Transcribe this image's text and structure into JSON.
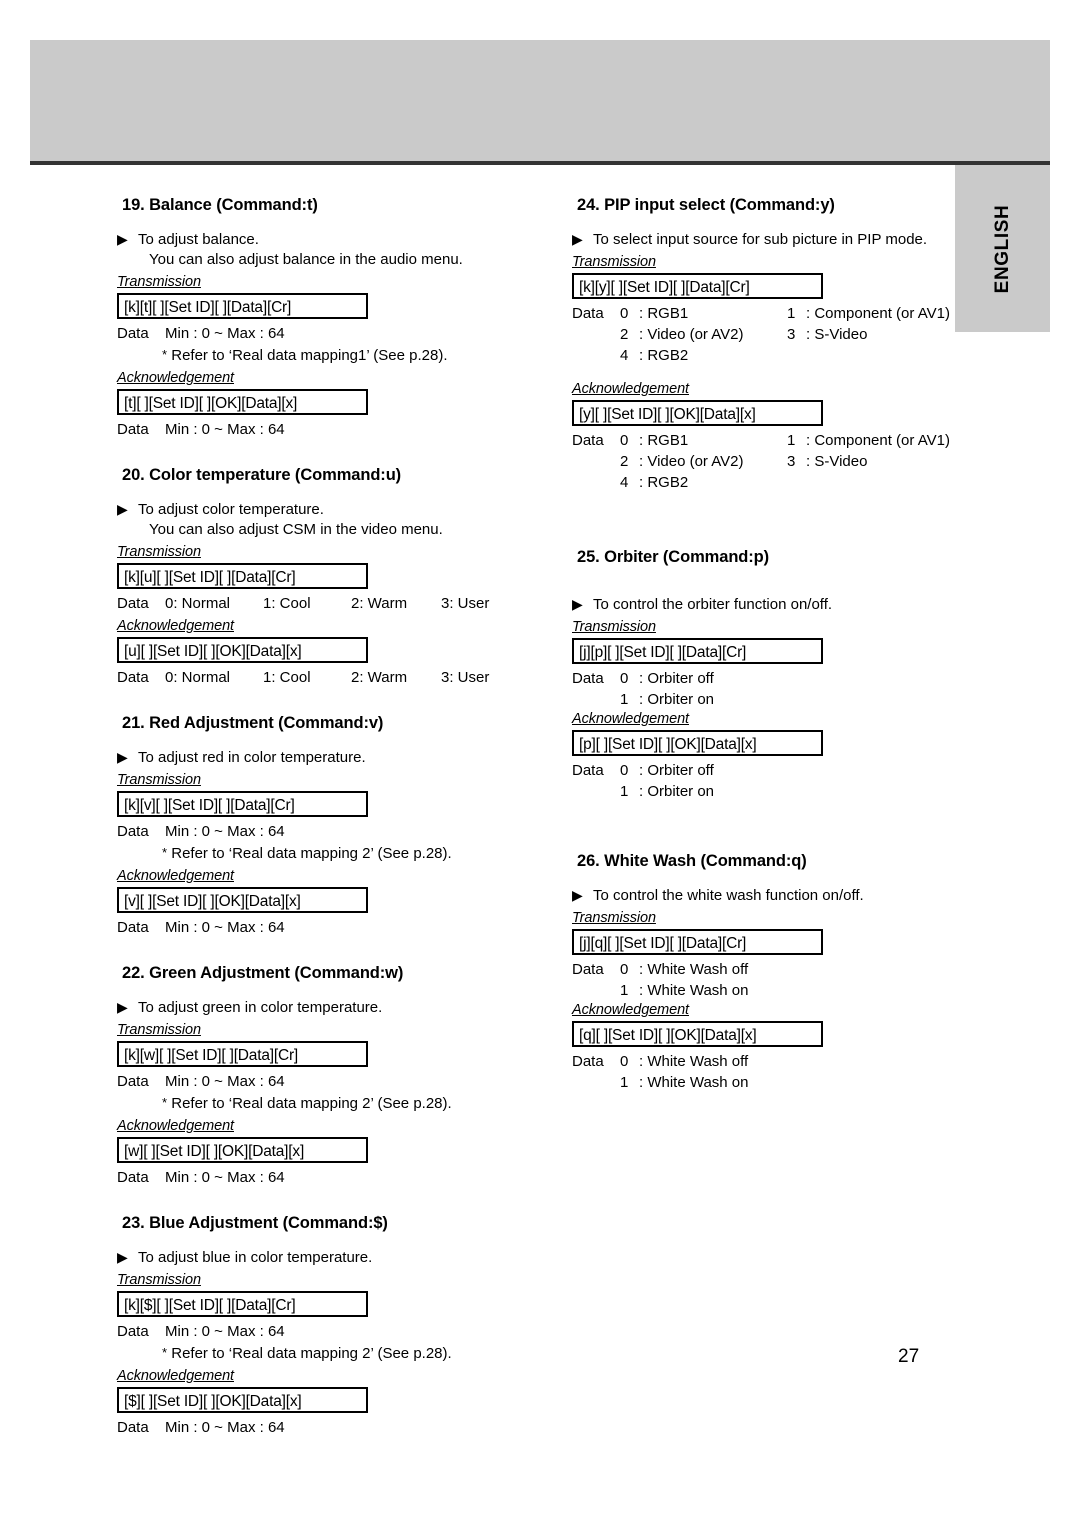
{
  "page": {
    "number": "27",
    "side_tab_label": "ENGLISH"
  },
  "labels": {
    "transmission": "Transmission",
    "acknowledgement": "Acknowledgement",
    "data": "Data",
    "triangle_bullet": "▶",
    "asterisk": "*"
  },
  "left_column": [
    {
      "title": "19. Balance (Command:t)",
      "desc_line1": "To adjust balance.",
      "desc_line2": "You can also adjust balance in the audio menu.",
      "transmission_box": "[k][t][  ][Set ID][  ][Data][Cr]",
      "transmission_data": "Min : 0 ~ Max : 64",
      "transmission_note": "Refer to ‘Real data mapping1’ (See p.28).",
      "ack_box": "[t][  ][Set ID][  ][OK][Data][x]",
      "ack_data": "Min : 0 ~ Max : 64"
    },
    {
      "title": "20. Color temperature (Command:u)",
      "desc_line1": "To adjust color temperature.",
      "desc_line2": "You can also adjust CSM in the video menu.",
      "transmission_box": "[k][u][  ][Set ID][  ][Data][Cr]",
      "options": [
        "0: Normal",
        "1: Cool",
        "2: Warm",
        "3: User"
      ],
      "ack_box": "[u][  ][Set ID][  ][OK][Data][x]",
      "ack_options": [
        "0: Normal",
        "1: Cool",
        "2: Warm",
        "3: User"
      ]
    },
    {
      "title": "21. Red Adjustment (Command:v)",
      "desc_line1": "To adjust red in color temperature.",
      "transmission_box": "[k][v][  ][Set ID][  ][Data][Cr]",
      "transmission_data": "Min : 0 ~ Max : 64",
      "transmission_note": "Refer to ‘Real data mapping 2’ (See p.28).",
      "ack_box": "[v][  ][Set ID][  ][OK][Data][x]",
      "ack_data": "Min : 0 ~ Max : 64"
    },
    {
      "title": "22. Green Adjustment (Command:w)",
      "desc_line1": "To adjust green in color temperature.",
      "transmission_box": "[k][w][  ][Set ID][  ][Data][Cr]",
      "transmission_data": "Min : 0 ~ Max : 64",
      "transmission_note": "Refer to ‘Real data mapping 2’ (See p.28).",
      "ack_box": "[w][  ][Set ID][  ][OK][Data][x]",
      "ack_data": "Min : 0 ~ Max : 64"
    },
    {
      "title": "23. Blue Adjustment (Command:$)",
      "desc_line1": "To adjust blue in color temperature.",
      "transmission_box": "[k][$][  ][Set ID][  ][Data][Cr]",
      "transmission_data": "Min : 0 ~ Max : 64",
      "transmission_note": "Refer to ‘Real data mapping 2’ (See p.28).",
      "ack_box": "[$][  ][Set ID][  ][OK][Data][x]",
      "ack_data": "Min : 0 ~ Max : 64"
    }
  ],
  "right_column": [
    {
      "title": "24. PIP input select (Command:y)",
      "desc_line1": "To select input source for sub picture in PIP mode.",
      "transmission_box": "[k][y][  ][Set ID][  ][Data][Cr]",
      "values": [
        {
          "n1": "0",
          "v1": ": RGB1",
          "n2": "1",
          "v2": ": Component (or AV1)"
        },
        {
          "n1": "2",
          "v1": ": Video (or AV2)",
          "n2": "3",
          "v2": ": S-Video"
        },
        {
          "n1": "4",
          "v1": ": RGB2",
          "n2": "",
          "v2": ""
        }
      ],
      "ack_box": "[y][  ][Set ID][  ][OK][Data][x]",
      "ack_values": [
        {
          "n1": "0",
          "v1": ": RGB1",
          "n2": "1",
          "v2": ": Component (or AV1)"
        },
        {
          "n1": "2",
          "v1": ": Video (or AV2)",
          "n2": "3",
          "v2": ": S-Video"
        },
        {
          "n1": "4",
          "v1": ": RGB2",
          "n2": "",
          "v2": ""
        }
      ]
    },
    {
      "title": "25. Orbiter (Command:p)",
      "desc_line1": "To control the orbiter function on/off.",
      "transmission_box": "[j][p][  ][Set ID][  ][Data][Cr]",
      "pairs": [
        {
          "num": "0",
          "text": ": Orbiter off"
        },
        {
          "num": "1",
          "text": ": Orbiter on"
        }
      ],
      "ack_box": "[p][  ][Set ID][  ][OK][Data][x]",
      "ack_pairs": [
        {
          "num": "0",
          "text": ": Orbiter off"
        },
        {
          "num": "1",
          "text": ": Orbiter on"
        }
      ]
    },
    {
      "title": "26. White Wash (Command:q)",
      "desc_line1": "To control the white wash function on/off.",
      "transmission_box": "[j][q][  ][Set ID][  ][Data][Cr]",
      "pairs": [
        {
          "num": "0",
          "text": ": White Wash off"
        },
        {
          "num": "1",
          "text": ": White Wash on"
        }
      ],
      "ack_box": "[q][  ][Set ID][  ][OK][Data][x]",
      "ack_pairs": [
        {
          "num": "0",
          "text": ": White Wash off"
        },
        {
          "num": "1",
          "text": ": White Wash on"
        }
      ]
    }
  ]
}
